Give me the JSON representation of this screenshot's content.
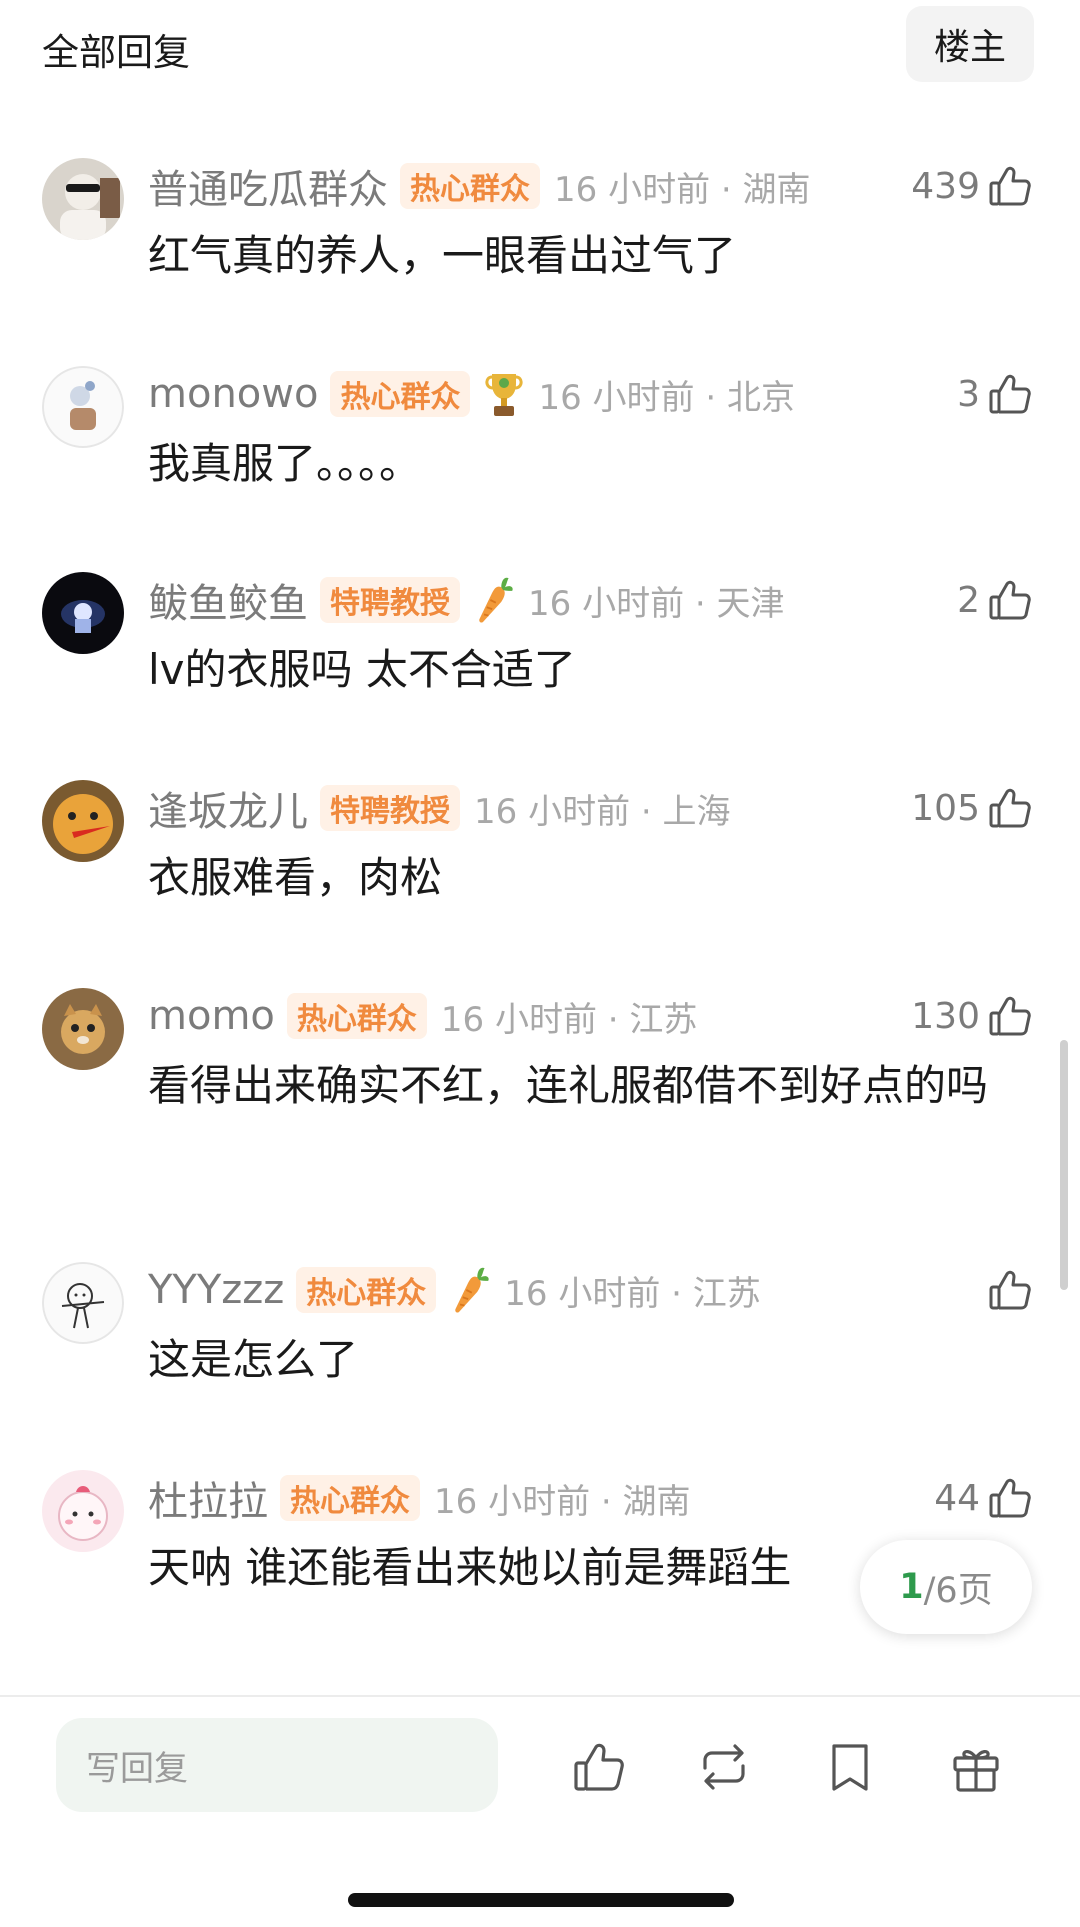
{
  "header": {
    "title": "全部回复",
    "op_button": "楼主"
  },
  "comments": [
    {
      "username": "普通吃瓜群众",
      "badge": "热心群众",
      "time": "16 小时前 · 湖南",
      "likes": "439",
      "text": "红气真的养人，一眼看出过气了"
    },
    {
      "username": "monowo",
      "badge": "热心群众",
      "award": "trophy",
      "time": "16 小时前 · 北京",
      "likes": "3",
      "text": "我真服了。。。。"
    },
    {
      "username": "鲅鱼鲛鱼",
      "badge": "特聘教授",
      "award": "carrot",
      "time": "16 小时前 · 天津",
      "likes": "2",
      "text": "lv的衣服吗  太不合适了"
    },
    {
      "username": "逢坂龙儿",
      "badge": "特聘教授",
      "time": "16 小时前 · 上海",
      "likes": "105",
      "text": "衣服难看，肉松"
    },
    {
      "username": "momo",
      "badge": "热心群众",
      "time": "16 小时前 · 江苏",
      "likes": "130",
      "text": "看得出来确实不红，连礼服都借不到好点的吗"
    },
    {
      "username": "YYYzzz",
      "badge": "热心群众",
      "award": "carrot",
      "time": "16 小时前 · 江苏",
      "likes": "",
      "text": "这是怎么了"
    },
    {
      "username": "杜拉拉",
      "badge": "热心群众",
      "time": "16 小时前 · 湖南",
      "likes": "44",
      "text": "天呐 谁还能看出来她以前是舞蹈生"
    }
  ],
  "pager": {
    "current": "1",
    "total": "/6页"
  },
  "bottom_bar": {
    "reply_placeholder": "写回复",
    "icons": [
      "like-icon",
      "repost-icon",
      "bookmark-icon",
      "gift-icon"
    ]
  },
  "colors": {
    "badge_text": "#f08a3e",
    "badge_bg": "#fff1e6",
    "pager_current": "#2e9a4c"
  }
}
